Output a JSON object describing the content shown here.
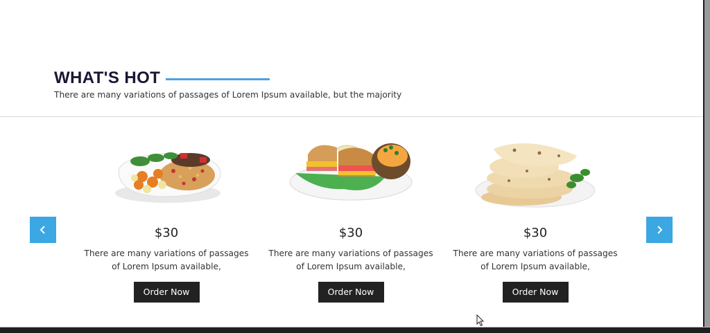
{
  "section": {
    "title": "WHAT'S HOT",
    "subtitle": "There are many variations of passages of Lorem Ipsum available, but the majority"
  },
  "carousel": {
    "prev_icon": "chevron-left-icon",
    "next_icon": "chevron-right-icon",
    "accent_color": "#3ba7e3",
    "items": [
      {
        "image": "rice-chicken-plate",
        "price": "$30",
        "description_line1": "There are many variations of passages",
        "description_line2": "of Lorem Ipsum available,",
        "button_label": "Order Now"
      },
      {
        "image": "sandwich-potato-plate",
        "price": "$30",
        "description_line1": "There are many variations of passages",
        "description_line2": "of Lorem Ipsum available,",
        "button_label": "Order Now"
      },
      {
        "image": "naan-bread-plate",
        "price": "$30",
        "description_line1": "There are many variations of passages",
        "description_line2": "of Lorem Ipsum available,",
        "button_label": "Order Now"
      }
    ]
  }
}
